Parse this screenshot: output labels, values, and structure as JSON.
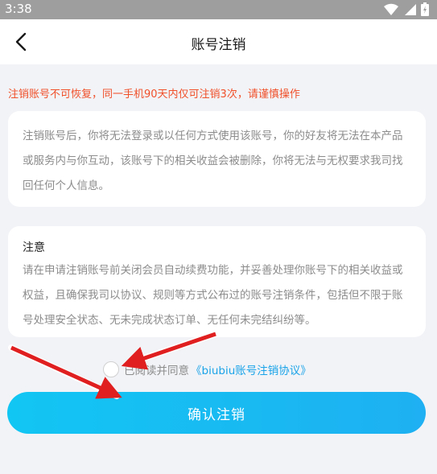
{
  "status_bar": {
    "time": "3:38",
    "icons": [
      "wifi-icon",
      "signal-icon",
      "battery-icon"
    ]
  },
  "header": {
    "title": "账号注销",
    "back_icon": "chevron-left-icon"
  },
  "warning_text": "注销账号不可恢复，同一手机90天内仅可注销3次，请谨慎操作",
  "card1": {
    "text": "注销账号后，你将无法登录或以任何方式使用该账号，你的好友将无法在本产品或服务内与你互动，该账号下的相关收益会被删除，你将无法与无权要求我司找回任何个人信息。"
  },
  "card2": {
    "title": "注意",
    "text": "请在申请注销账号前关闭会员自动续费功能，并妥善处理你账号下的相关收益或权益，且确保我司以协议、规则等方式公布过的账号注销条件，包括但不限于账号处理安全状态、无未完成状态订单、无任何未完结纠纷等。"
  },
  "agreement": {
    "prefix": "已阅读并同意",
    "link": "《biubiu账号注销协议》",
    "checked": false
  },
  "confirm_button": {
    "label": "确认注销"
  },
  "colors": {
    "accent": "#1aa3e8",
    "warning": "#f0502a",
    "arrow": "#e02020"
  }
}
